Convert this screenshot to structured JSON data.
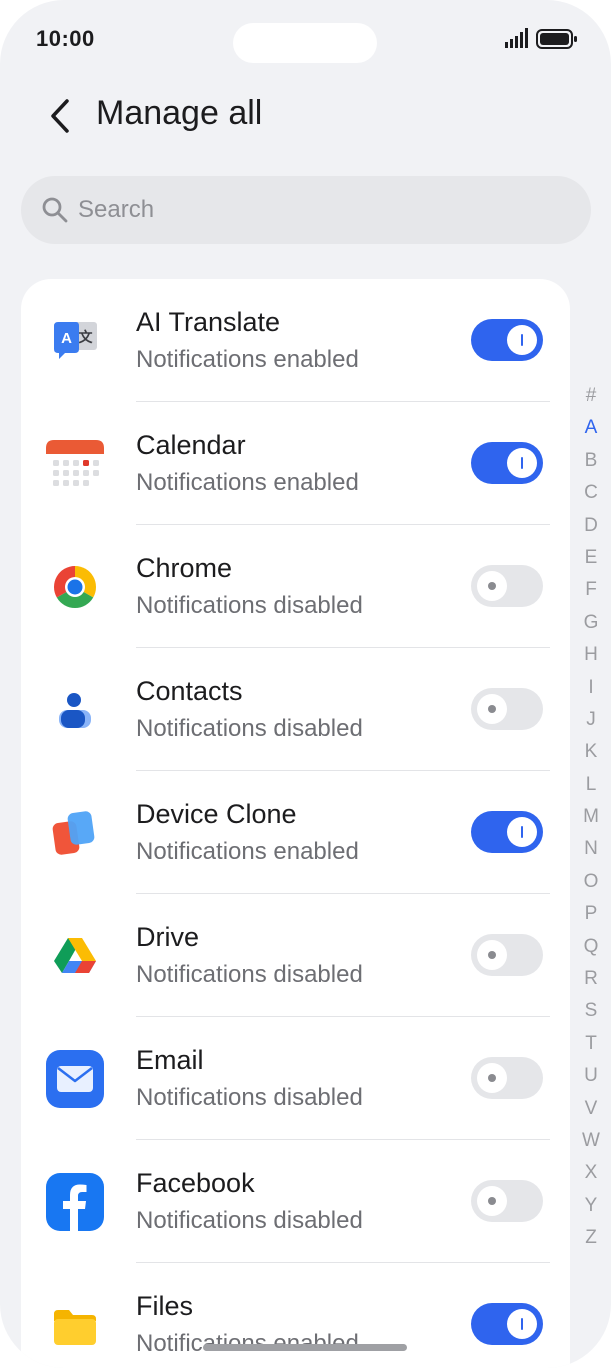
{
  "status_bar": {
    "time": "10:00"
  },
  "header": {
    "title": "Manage all"
  },
  "search": {
    "placeholder": "Search"
  },
  "apps": [
    {
      "name": "AI Translate",
      "status": "Notifications enabled",
      "enabled": true
    },
    {
      "name": "Calendar",
      "status": "Notifications enabled",
      "enabled": true
    },
    {
      "name": "Chrome",
      "status": "Notifications disabled",
      "enabled": false
    },
    {
      "name": "Contacts",
      "status": "Notifications disabled",
      "enabled": false
    },
    {
      "name": "Device Clone",
      "status": "Notifications enabled",
      "enabled": true
    },
    {
      "name": "Drive",
      "status": "Notifications disabled",
      "enabled": false
    },
    {
      "name": "Email",
      "status": "Notifications disabled",
      "enabled": false
    },
    {
      "name": "Facebook",
      "status": "Notifications disabled",
      "enabled": false
    },
    {
      "name": "Files",
      "status": "Notifications enabled",
      "enabled": true
    }
  ],
  "alphabet_index": {
    "letters": [
      "#",
      "A",
      "B",
      "C",
      "D",
      "E",
      "F",
      "G",
      "H",
      "I",
      "J",
      "K",
      "L",
      "M",
      "N",
      "O",
      "P",
      "Q",
      "R",
      "S",
      "T",
      "U",
      "V",
      "W",
      "X",
      "Y",
      "Z"
    ],
    "active": "A"
  },
  "colors": {
    "accent": "#2f64ee",
    "background": "#f1f2f5",
    "card": "#ffffff",
    "toggle_off": "#e5e6e9"
  }
}
